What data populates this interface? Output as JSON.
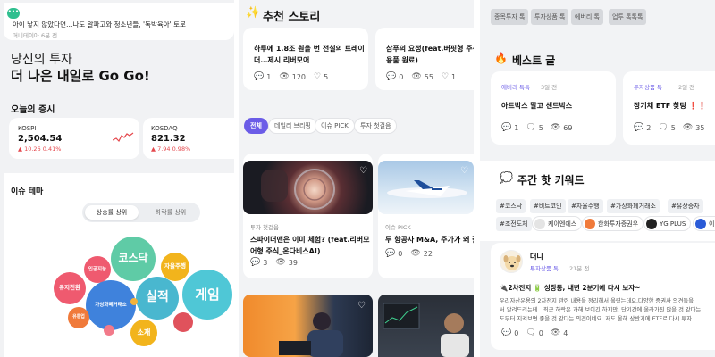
{
  "panel1": {
    "notice": {
      "text": "아이 낳지 않았다면…나도 알파고와 청소년들, '독박육아' 토로",
      "source": "머니테이아 6분 전"
    },
    "hero": {
      "line1": "당신의 투자",
      "line2": "더 나은 내일로 Go Go!"
    },
    "market": {
      "title": "오늘의 증시",
      "kospi": {
        "name": "KOSPI",
        "value": "2,504.54",
        "change": "▲ 10.26 0.41%"
      },
      "kosdaq": {
        "name": "KOSDAQ",
        "value": "821.32",
        "change": "▲ 7.94 0.98%"
      }
    },
    "theme": {
      "title": "이슈 테마",
      "toggle_on": "상승률 상위",
      "toggle_off": "하락률 상위",
      "bubbles": [
        {
          "label": "코스닥",
          "color": "#5fcba6"
        },
        {
          "label": "자율주행",
          "color": "#f2b41c"
        },
        {
          "label": "인공지능",
          "color": "#ef5a6f"
        },
        {
          "label": "게임",
          "color": "#4fc7d6"
        },
        {
          "label": "실적",
          "color": "#49b7cf"
        },
        {
          "label": "유지전환",
          "color": "#ef5a6f"
        },
        {
          "label": "가상화폐거래소",
          "color": "#3f82dc"
        },
        {
          "label": "소재",
          "color": "#f2b41c"
        },
        {
          "label": "유통업",
          "color": "#f07a3a"
        },
        {
          "label": "",
          "color": "#f27a8a"
        },
        {
          "label": "",
          "color": "#e0525c"
        },
        {
          "label": "",
          "color": "#f3b33c"
        }
      ]
    }
  },
  "panel2": {
    "title": "추천 스토리",
    "top_cards": [
      {
        "title1": "하루에 1.8조 원을 번 전설의 트레이",
        "title2": "더…제시 리버모어",
        "comments": "1",
        "views": "120",
        "likes": "5"
      },
      {
        "title1": "삼푸의 요정(feat.버핏형 주식_",
        "title2": "용품 원료)",
        "comments": "0",
        "views": "55",
        "likes": "1"
      }
    ],
    "filters": [
      "전체",
      "데일리 브리핑",
      "이슈 PICK",
      "투자 첫걸음"
    ],
    "stories": [
      {
        "category": "투자 첫걸음",
        "title1": "스파이더맨은 이미 체험? (feat.리버모",
        "title2": "어형 주식_온다비스AI)",
        "comments": "3",
        "views": "39"
      },
      {
        "category": "이슈 PICK",
        "title1": "두 항공사 M&A, 주가가 왜 갈린",
        "title2": "",
        "comments": "0",
        "views": "22"
      }
    ]
  },
  "panel3": {
    "top_tags": [
      "종목투자 톡",
      "투자상품 톡",
      "에버리 톡",
      "업투 톡톡톡"
    ],
    "best": {
      "title": "베스트 글",
      "posts": [
        {
          "board": "에버리 톡톡",
          "time": "3일 전",
          "title": "아트박스 말고 샌드박스",
          "comments": "1",
          "replies": "5",
          "views": "69"
        },
        {
          "board": "투자상품 톡",
          "time": "2일 전",
          "title": "장기채 ETF 찾팅 ❗❗",
          "comments": "2",
          "replies": "5",
          "views": "35"
        }
      ]
    },
    "keywords": {
      "title": "주간 핫 키워드",
      "tags": [
        "#코스닥",
        "#비트코인",
        "#자율주행",
        "#가상화폐거래소",
        "#유상증자",
        "#조전도체"
      ],
      "brands": [
        {
          "name": "케이엔에스",
          "color": "#e4e4e4"
        },
        {
          "name": "한화투자증권우",
          "color": "#f07a3a"
        },
        {
          "name": "YG PLUS",
          "color": "#222222"
        },
        {
          "name": "이",
          "color": "#2a5bd7"
        }
      ]
    },
    "post": {
      "author": "대니",
      "board": "투자상품 톡",
      "time": "21분 전",
      "title": "🔌2차전지 🔋 성장통, 내년 2분기에 다시 보자~",
      "body1": "우리자산운용의 2차전지 관련 내용을 정리해서 올렸는데요.다양한 증권사 의견들을",
      "body2": "서 알려드리는데…최근 하락은 과해 보이긴 하지만, 단기간에 올라가진 않을 것 같다는",
      "body3": "도부터 지켜보면 좋을 것 같다는 의견이네요. 저도 올해 상반기에 ETF로 다시 투자",
      "comments": "0",
      "replies": "0",
      "views": "4"
    }
  }
}
